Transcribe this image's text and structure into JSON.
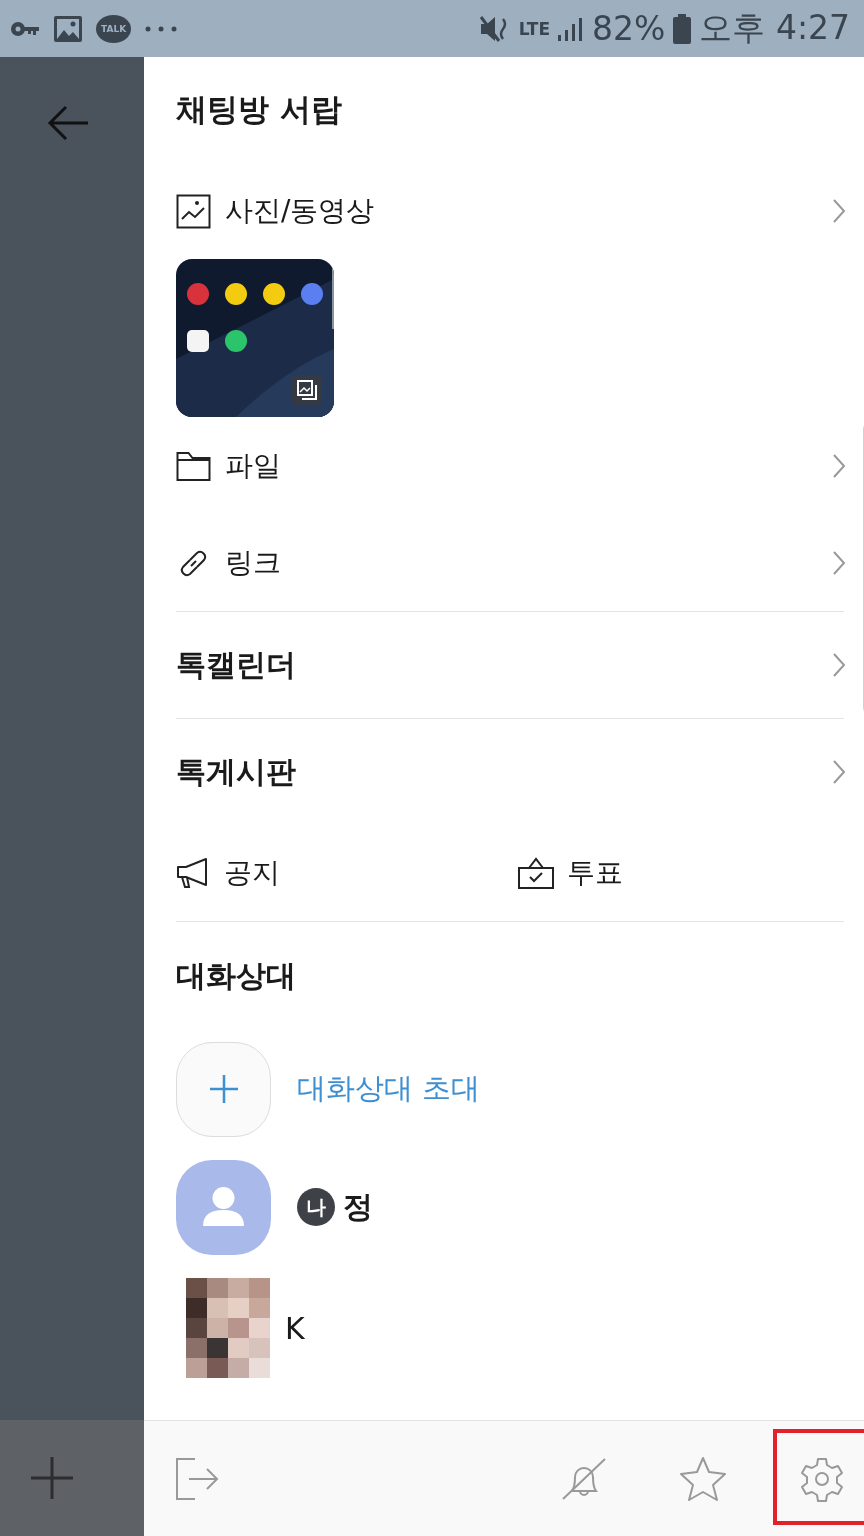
{
  "status_bar": {
    "talk_badge": "TALK",
    "network": "LTE",
    "battery": "82%",
    "time": "오후 4:27"
  },
  "drawer": {
    "title": "채팅방 서랍",
    "items": [
      {
        "kind": "media",
        "label": "사진/동영상"
      },
      {
        "kind": "file",
        "label": "파일"
      },
      {
        "kind": "link",
        "label": "링크"
      },
      {
        "kind": "divider"
      },
      {
        "kind": "section",
        "label": "톡캘린더"
      },
      {
        "kind": "divider"
      },
      {
        "kind": "section",
        "label": "톡게시판"
      },
      {
        "kind": "pair",
        "left": "공지",
        "right": "투표"
      },
      {
        "kind": "divider"
      }
    ],
    "members": {
      "title": "대화상대",
      "invite": "대화상대 초대",
      "people": [
        {
          "kind": "default",
          "name": "정",
          "badge": "나"
        },
        {
          "kind": "picture",
          "name": "K"
        }
      ]
    }
  }
}
